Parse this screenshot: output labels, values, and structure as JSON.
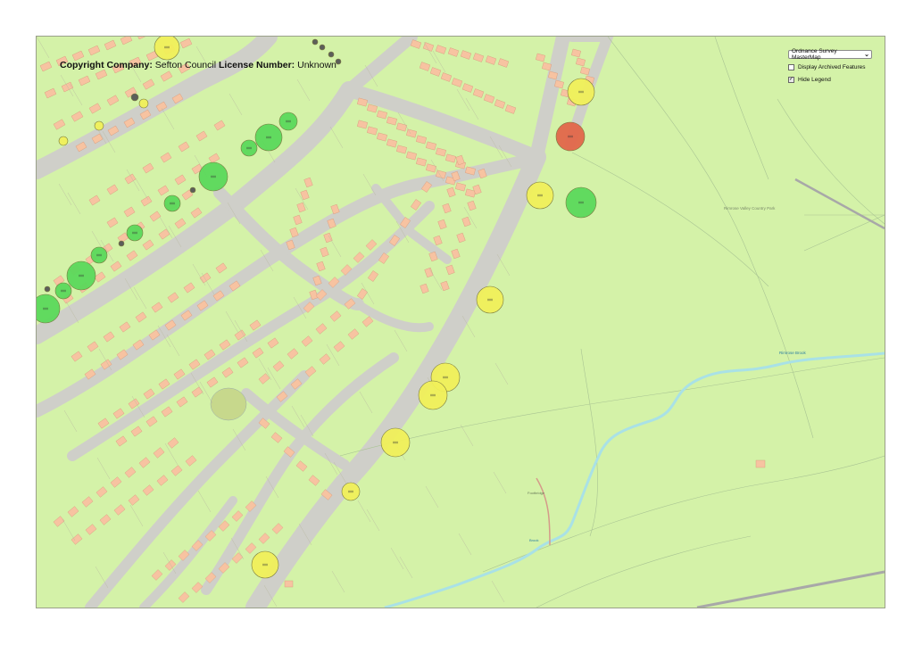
{
  "copyright": {
    "company_label": "Copyright Company:",
    "company_value": "Sefton Council",
    "license_label": "License Number:",
    "license_value": "Unknown"
  },
  "layers": {
    "selected": "Ordnance Survey MasterMap",
    "display_archived_label": "Display Archived Features",
    "display_archived_checked": false,
    "hide_legend_label": "Hide Legend",
    "hide_legend_checked": true
  },
  "colors": {
    "land": "#d4f2a8",
    "building": "#f7c3a1",
    "road": "#cfcfc9",
    "river": "#a9e1e6",
    "tree_good": "#5bd85b",
    "tree_fair": "#f0ef5a",
    "tree_poor": "#e2664a",
    "tree_dead": "#555555"
  },
  "map_labels": {
    "park": "Rimrose Valley Country Park",
    "brook": "Rimrose Brook",
    "brook_lower": "Brook",
    "footbridge": "Footbridge"
  }
}
